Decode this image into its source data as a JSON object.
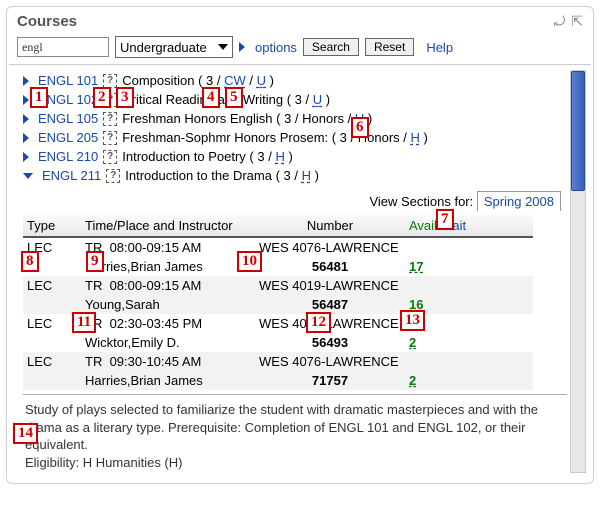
{
  "header": {
    "title": "Courses"
  },
  "toolbar": {
    "search_value": "engl",
    "level_label": "Undergraduate",
    "options_label": "options",
    "search_btn": "Search",
    "reset_btn": "Reset",
    "help_label": "Help"
  },
  "courses": [
    {
      "code": "ENGL 101",
      "title_prefix": "Composition ( 3 / ",
      "attr1": "CW",
      "sep": " / ",
      "attr2": "U",
      "title_suffix": " )",
      "expanded": false
    },
    {
      "code": "ENGL 102",
      "title_prefix": "Critical Reading and Writing ( 3 / ",
      "attr1": "U",
      "sep": "",
      "attr2": "",
      "title_suffix": " )",
      "expanded": false
    },
    {
      "code": "ENGL 105",
      "title_prefix": "Freshman Honors English ( 3 / Honors / ",
      "attr1": "U",
      "sep": "",
      "attr2": "",
      "title_suffix": " )",
      "expanded": false
    },
    {
      "code": "ENGL 205",
      "title_prefix": "Freshman-Sophmr Honors Prosem: ( 3 / Honors / ",
      "attr1": "H",
      "sep": "",
      "attr2": "",
      "title_suffix": " )",
      "expanded": false
    },
    {
      "code": "ENGL 210",
      "title_prefix": "Introduction to Poetry ( 3 / ",
      "attr1": "H",
      "sep": "",
      "attr2": "",
      "title_suffix": " )",
      "expanded": false
    },
    {
      "code": "ENGL 211",
      "title_prefix": "Introduction to the Drama ( 3 / ",
      "attr1": "H",
      "sep": "",
      "attr2": "",
      "title_suffix": " )",
      "expanded": true
    }
  ],
  "view_sections": {
    "label": "View Sections for:",
    "term": "Spring 2008"
  },
  "sections": {
    "headers": {
      "type": "Type",
      "time": "Time/Place and Instructor",
      "number": "Number",
      "avail": "Avail",
      "sep": "/",
      "wait": "Wait"
    },
    "rows": [
      {
        "type": "LEC",
        "days": "TR",
        "time": "08:00-09:15 AM",
        "loc": "WES 4076-LAWRENCE",
        "instr": "Harries,Brian James",
        "num": "56481",
        "avail": "17"
      },
      {
        "type": "LEC",
        "days": "TR",
        "time": "08:00-09:15 AM",
        "loc": "WES 4019-LAWRENCE",
        "instr": "Young,Sarah",
        "num": "56487",
        "avail": "16"
      },
      {
        "type": "LEC",
        "days": "TR",
        "time": "02:30-03:45 PM",
        "loc": "WES 4019-LAWRENCE",
        "instr": "Wicktor,Emily D.",
        "num": "56493",
        "avail": "2"
      },
      {
        "type": "LEC",
        "days": "TR",
        "time": "09:30-10:45 AM",
        "loc": "WES 4076-LAWRENCE",
        "instr": "Harries,Brian James",
        "num": "71757",
        "avail": "2"
      }
    ]
  },
  "description": {
    "body": "Study of plays selected to familiarize the student with dramatic masterpieces and with the drama as a literary type. Prerequisite: Completion of ENGL 101 and ENGL 102, or their equivalent.",
    "eligibility": "Eligibility: H Humanities (H)"
  },
  "markers": {
    "m1": "1",
    "m2": "2",
    "m3": "3",
    "m4": "4",
    "m5": "5",
    "m6": "6",
    "m7": "7",
    "m8": "8",
    "m9": "9",
    "m10": "10",
    "m11": "11",
    "m12": "12",
    "m13": "13",
    "m14": "14"
  }
}
